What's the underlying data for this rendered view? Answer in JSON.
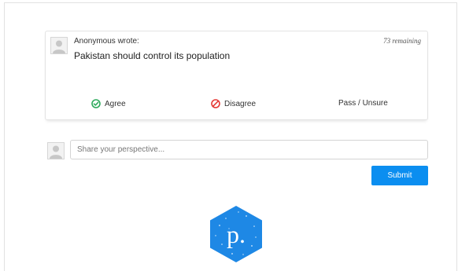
{
  "card": {
    "author": "Anonymous wrote:",
    "remaining": "73 remaining",
    "comment": "Pakistan should control its population"
  },
  "votes": {
    "agree": "Agree",
    "disagree": "Disagree",
    "pass": "Pass / Unsure"
  },
  "composer": {
    "placeholder": "Share your perspective...",
    "value": ""
  },
  "submit_label": "Submit",
  "logo": {
    "letter": "p.",
    "color": "#1e88e5"
  },
  "colors": {
    "agree": "#2eaa5c",
    "disagree": "#e53935",
    "submit": "#0b8ef0"
  }
}
